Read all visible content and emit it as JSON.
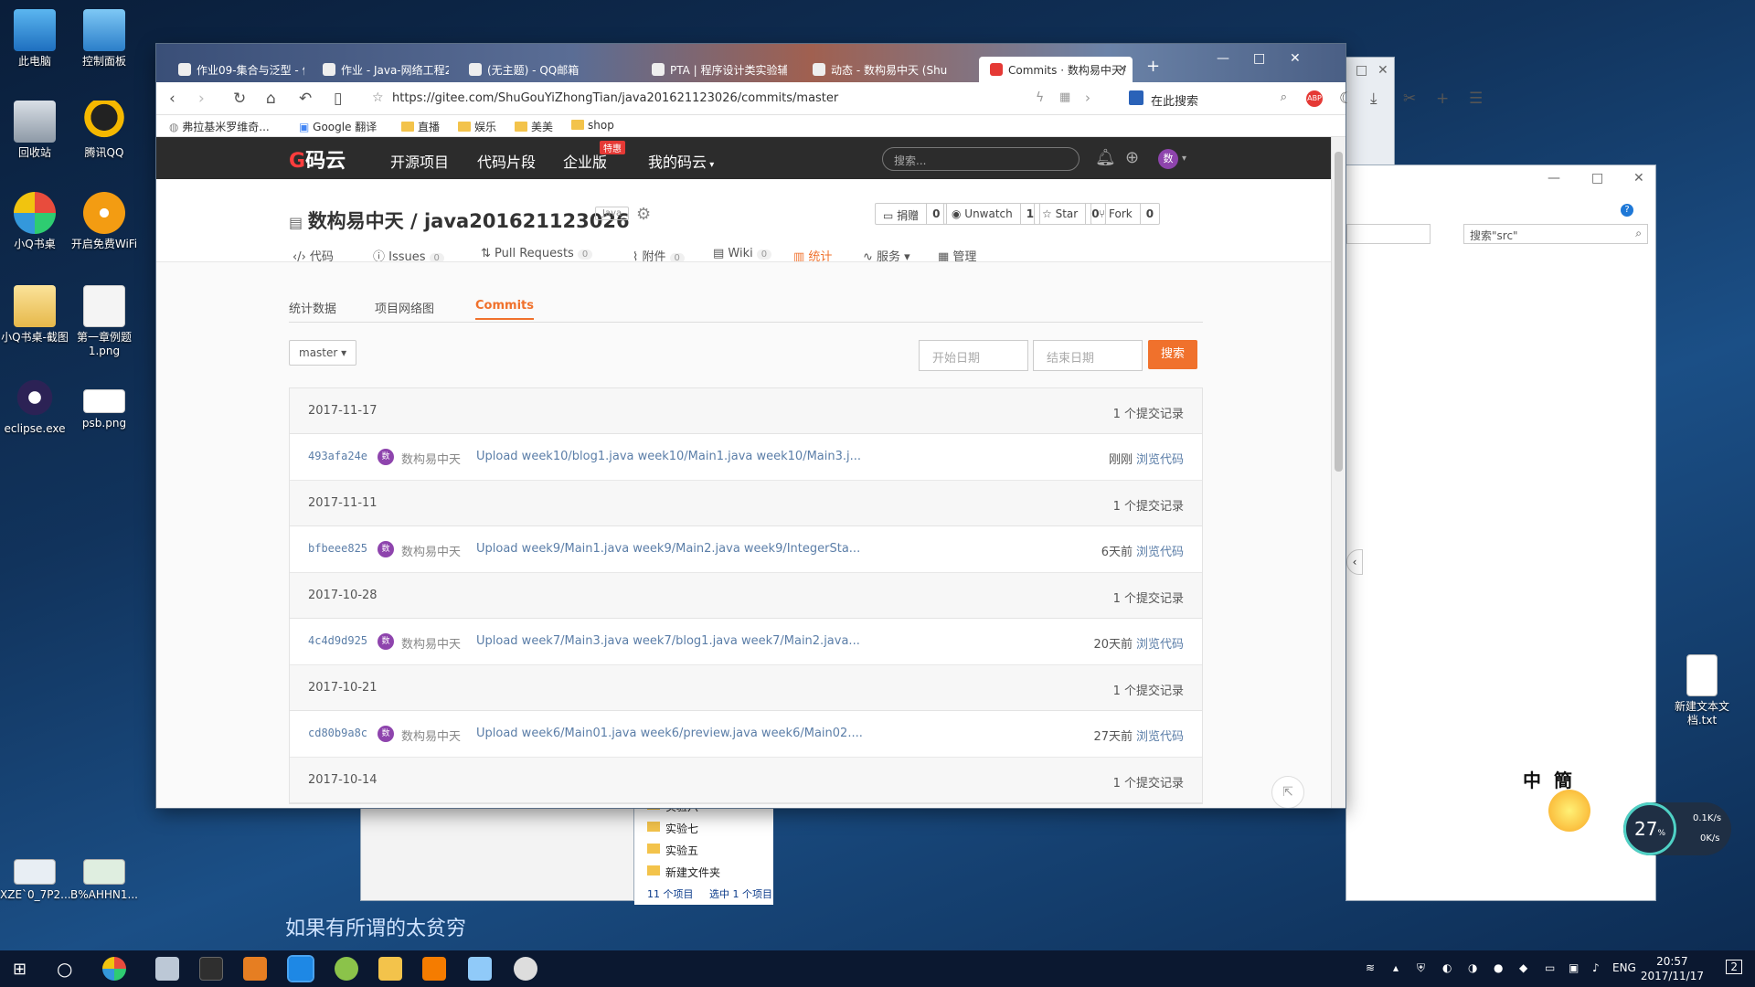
{
  "desktop": {
    "icons": [
      {
        "label": "此电脑"
      },
      {
        "label": "控制面板"
      },
      {
        "label": "回收站"
      },
      {
        "label": "腾讯QQ"
      },
      {
        "label": "小Q书桌"
      },
      {
        "label": "开启免费WiFi"
      },
      {
        "label": "小Q书桌-截图"
      },
      {
        "label": "第一章例题1.png"
      },
      {
        "label": "eclipse.exe"
      },
      {
        "label": "psb.png"
      },
      {
        "label": "XZE`0_7P2..."
      },
      {
        "label": "B%AHHN1..."
      },
      {
        "label": "新建文本文档.txt"
      }
    ],
    "subtitle": "如果有所谓的太贫穷",
    "widget_chars": [
      "中",
      "簡"
    ],
    "net_percent": "27",
    "net_percent_unit": "%",
    "net_up": "0.1K/s",
    "net_down": "0K/s"
  },
  "browser": {
    "tabs": [
      {
        "label": "作业09-集合与泛型 - 作"
      },
      {
        "label": "作业 - Java-网络工程20"
      },
      {
        "label": "(无主题) - QQ邮箱"
      },
      {
        "label": "PTA | 程序设计类实验辅"
      },
      {
        "label": "动态 - 数构易中天 (Shu"
      },
      {
        "label": "Commits · 数构易中天/"
      }
    ],
    "url": "https://gitee.com/ShuGouYiZhongTian/java201621123026/commits/master",
    "search_placeholder": "在此搜索",
    "bookmarks": [
      "弗拉基米罗维奇...",
      "Google 翻译",
      "直播",
      "娱乐",
      "美美",
      "shop"
    ]
  },
  "site": {
    "logo": "码云",
    "nav": [
      "开源项目",
      "代码片段",
      "企业版",
      "我的码云"
    ],
    "hot_badge": "特惠",
    "search_placeholder": "搜索...",
    "avatar_initial": "数"
  },
  "repo": {
    "owner": "数构易中天",
    "separator": "/",
    "name": "java201621123026",
    "language": "Java",
    "actions": [
      {
        "label": "捐赠",
        "count": "0"
      },
      {
        "label": "Unwatch",
        "count": "1"
      },
      {
        "label": "Star",
        "count": "0"
      },
      {
        "label": "Fork",
        "count": "0"
      }
    ],
    "tabs": [
      {
        "label": "代码",
        "count": ""
      },
      {
        "label": "Issues",
        "count": "0"
      },
      {
        "label": "Pull Requests",
        "count": "0"
      },
      {
        "label": "附件",
        "count": "0"
      },
      {
        "label": "Wiki",
        "count": "0"
      },
      {
        "label": "统计",
        "count": ""
      },
      {
        "label": "服务",
        "count": ""
      },
      {
        "label": "管理",
        "count": ""
      }
    ],
    "active_tab": "统计"
  },
  "stats": {
    "subtabs": [
      "统计数据",
      "项目网络图",
      "Commits"
    ],
    "branch": "master",
    "start_date_placeholder": "开始日期",
    "end_date_placeholder": "结束日期",
    "search_button": "搜索"
  },
  "commit_groups": [
    {
      "date": "2017-11-17",
      "count_label": "1 个提交记录",
      "sha": "493afa24e",
      "author": "数构易中天",
      "message": "Upload week10/blog1.java week10/Main1.java week10/Main3.j...",
      "time": "刚刚",
      "browse": "浏览代码"
    },
    {
      "date": "2017-11-11",
      "count_label": "1 个提交记录",
      "sha": "bfbeee825",
      "author": "数构易中天",
      "message": "Upload week9/Main1.java week9/Main2.java week9/IntegerSta...",
      "time": "6天前",
      "browse": "浏览代码"
    },
    {
      "date": "2017-10-28",
      "count_label": "1 个提交记录",
      "sha": "4c4d9d925",
      "author": "数构易中天",
      "message": "Upload week7/Main3.java week7/blog1.java week7/Main2.java...",
      "time": "20天前",
      "browse": "浏览代码"
    },
    {
      "date": "2017-10-21",
      "count_label": "1 个提交记录",
      "sha": "cd80b9a8c",
      "author": "数构易中天",
      "message": "Upload week6/Main01.java week6/preview.java week6/Main02....",
      "time": "27天前",
      "browse": "浏览代码"
    },
    {
      "date": "2017-10-14",
      "count_label": "1 个提交记录"
    }
  ],
  "explorer": {
    "search_placeholder": "搜索\"src\"",
    "items": [
      "实验六",
      "实验七",
      "实验五",
      "新建文件夹"
    ],
    "status_count": "11 个项目",
    "status_selected": "选中 1 个项目"
  },
  "taskbar": {
    "lang": "ENG",
    "time": "20:57",
    "date": "2017/11/17",
    "notif": "2"
  }
}
